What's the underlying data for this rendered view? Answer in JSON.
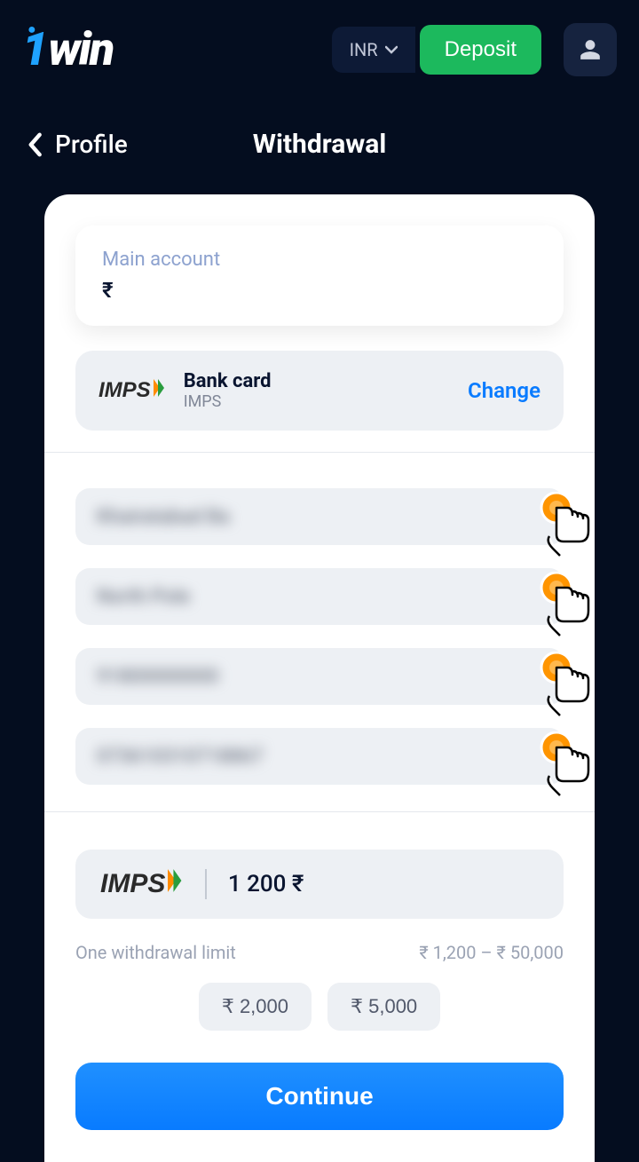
{
  "header": {
    "currency": "INR",
    "deposit_label": "Deposit"
  },
  "nav": {
    "back_label": "Profile",
    "title": "Withdrawal"
  },
  "account": {
    "label": "Main account",
    "symbol": "₹"
  },
  "method": {
    "name": "Bank card",
    "sub": "IMPS",
    "change_label": "Change"
  },
  "amount": {
    "value": "1 200 ₹"
  },
  "limit": {
    "label": "One withdrawal limit",
    "range": "₹ 1,200 – ₹ 50,000"
  },
  "chips": [
    "₹ 2,000",
    "₹ 5,000"
  ],
  "continue_label": "Continue"
}
